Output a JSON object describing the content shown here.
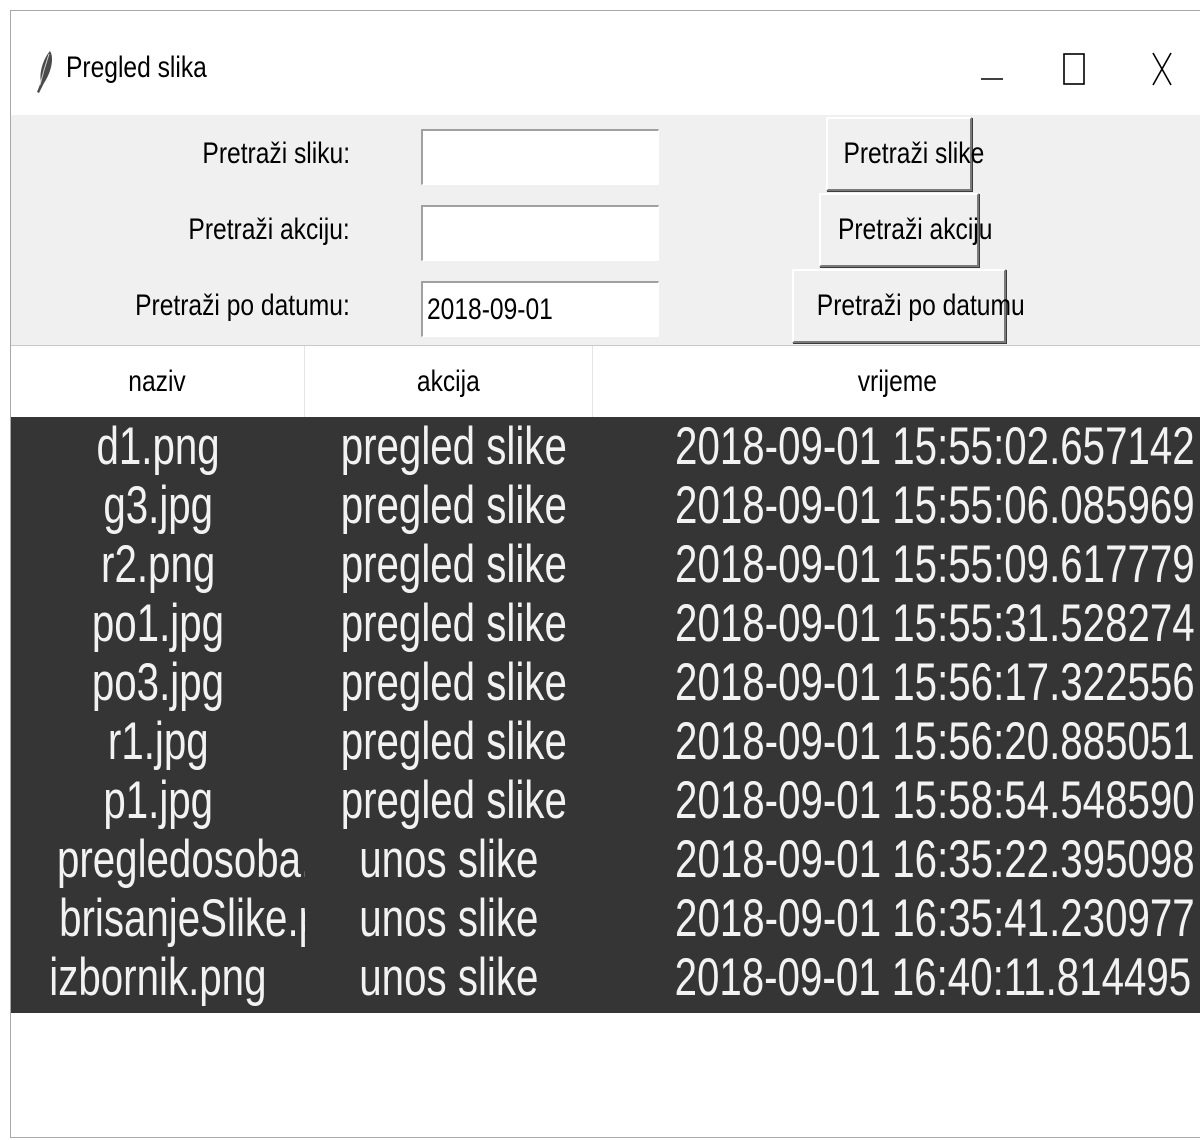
{
  "window": {
    "title": "Pregled slika",
    "icon": "feather-icon",
    "controls": {
      "minimize_icon": "minimize-icon",
      "maximize_icon": "maximize-icon",
      "close_icon": "close-icon"
    }
  },
  "search": {
    "image_label": "Pretraži sliku:",
    "image_value": "",
    "action_label": "Pretraži akciju:",
    "action_value": "",
    "date_label": "Pretraži po datumu:",
    "date_value": "2018-09-01",
    "image_button": "Pretraži slike",
    "action_button": "Pretraži akciju",
    "date_button": "Pretraži po datumu"
  },
  "table": {
    "columns": [
      "naziv",
      "akcija",
      "vrijeme"
    ],
    "rows": [
      [
        "d1.png",
        "pregled slike",
        "2018-09-01 15:55:02.657142"
      ],
      [
        "g3.jpg",
        "pregled slike",
        "2018-09-01 15:55:06.085969"
      ],
      [
        "r2.png",
        "pregled slike",
        "2018-09-01 15:55:09.617779"
      ],
      [
        "po1.jpg",
        "pregled slike",
        "2018-09-01 15:55:31.528274"
      ],
      [
        "po3.jpg",
        "pregled slike",
        "2018-09-01 15:56:17.322556"
      ],
      [
        "r1.jpg",
        "pregled slike",
        "2018-09-01 15:56:20.885051"
      ],
      [
        "p1.jpg",
        "pregled slike",
        "2018-09-01 15:58:54.548590"
      ],
      [
        "pregledosoba.pr",
        "unos slike",
        "2018-09-01 16:35:22.395098"
      ],
      [
        "brisanjeSlike.pnc",
        "unos slike",
        "2018-09-01 16:35:41.230977"
      ],
      [
        "izbornik.png",
        "unos slike",
        "2018-09-01 16:40:11.814495"
      ]
    ]
  },
  "colors": {
    "table_background": "#353535",
    "table_text": "#f2f2f2",
    "form_background": "#f0f0f0"
  }
}
